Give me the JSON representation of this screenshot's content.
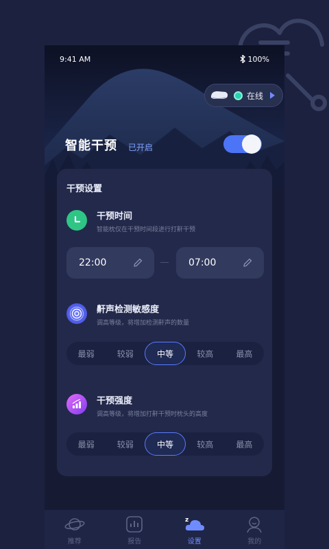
{
  "status_bar": {
    "time": "9:41 AM",
    "battery": "100%"
  },
  "device": {
    "status": "在线"
  },
  "smart_intervention": {
    "title": "智能干预",
    "status": "已开启",
    "enabled": true
  },
  "settings": {
    "title": "干预设置",
    "time": {
      "title": "干预时间",
      "desc": "智能枕仅在干预时间段进行打鼾干预",
      "start": "22:00",
      "end": "07:00"
    },
    "sensitivity": {
      "title": "鼾声检测敏感度",
      "desc": "调高等级，将增加检测鼾声的数量",
      "options": [
        "最弱",
        "较弱",
        "中等",
        "较高",
        "最高"
      ],
      "selected": "中等"
    },
    "strength": {
      "title": "干预强度",
      "desc": "调高等级，将增加打鼾干预时枕头的高度",
      "options": [
        "最弱",
        "较弱",
        "中等",
        "较高",
        "最高"
      ],
      "selected": "中等"
    }
  },
  "tabs": [
    {
      "label": "推荐",
      "icon": "planet-icon"
    },
    {
      "label": "报告",
      "icon": "report-chart-icon"
    },
    {
      "label": "设置",
      "icon": "sleep-cloud-icon",
      "active": true
    },
    {
      "label": "我的",
      "icon": "user-icon"
    }
  ],
  "colors": {
    "accent": "#4c74f6",
    "online": "#28d2b0",
    "background": "#1c2140",
    "card": "#23294a"
  }
}
